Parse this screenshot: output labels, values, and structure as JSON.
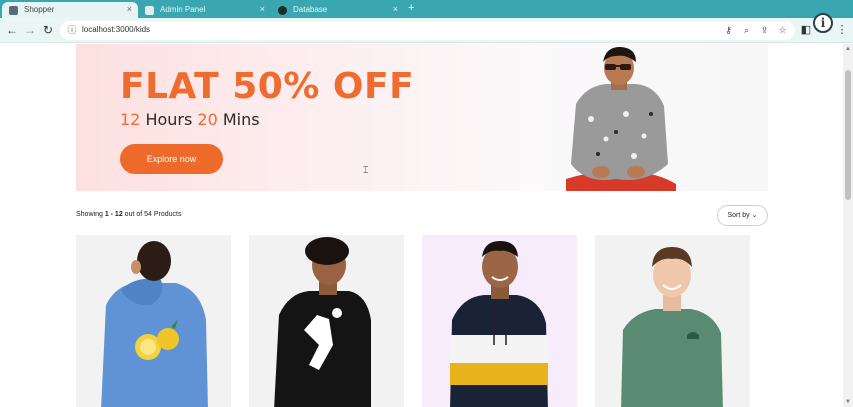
{
  "browser": {
    "tabs": [
      {
        "title": "Shopper",
        "active": true
      },
      {
        "title": "Admin Panel",
        "active": false
      },
      {
        "title": "Database",
        "active": false
      }
    ],
    "url": "localhost:3000/kids",
    "overlay_icon": "info-icon"
  },
  "banner": {
    "title": "FLAT 50% OFF",
    "hours_num": "12",
    "hours_label": "Hours",
    "mins_num": "20",
    "mins_label": "Mins",
    "cta_label": "Explore now",
    "accent_color": "#ee6a2a"
  },
  "results": {
    "showing_prefix": "Showing",
    "range": "1 - 12",
    "suffix": "out of 54 Products",
    "sort_label": "Sort by"
  },
  "products": [
    {
      "image_alt": "boy-blue-hoodie-lemons",
      "bg": "#f2f2f2"
    },
    {
      "image_alt": "boy-black-hoodie",
      "bg": "#f2f2f2"
    },
    {
      "image_alt": "boy-navy-white-yellow-hoodie",
      "bg": "#f7ecfb"
    },
    {
      "image_alt": "boy-green-sweatshirt",
      "bg": "#f2f2f2"
    }
  ]
}
